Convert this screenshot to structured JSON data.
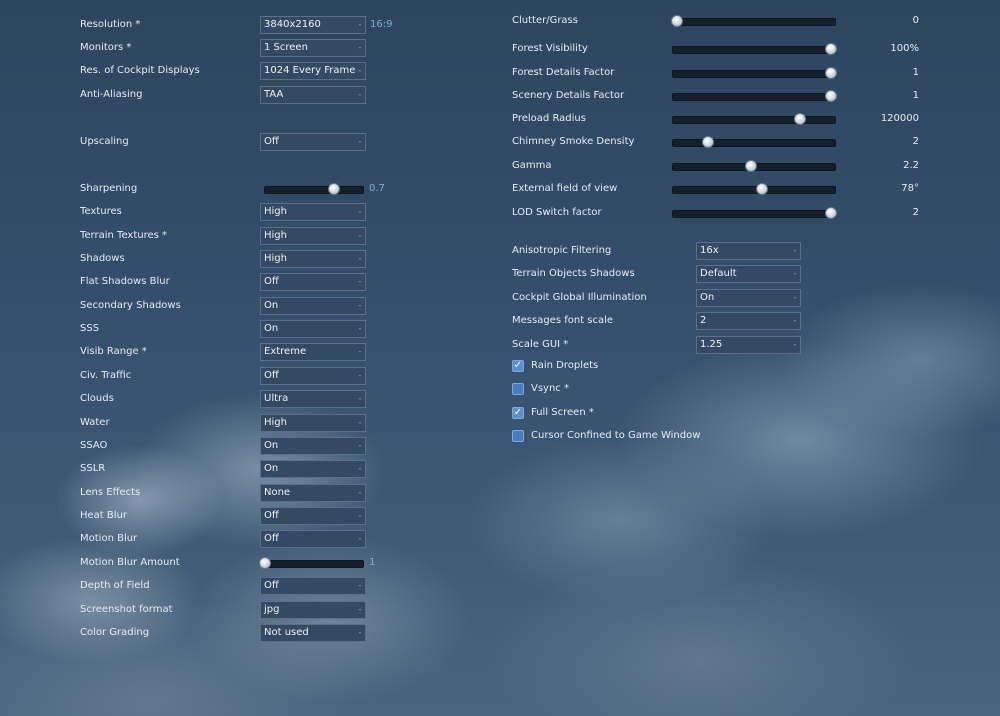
{
  "left": [
    {
      "id": "resolution",
      "kind": "dropdown",
      "label": "Resolution *",
      "value": "3840x2160",
      "note": "16:9"
    },
    {
      "id": "monitors",
      "kind": "dropdown",
      "label": "Monitors *",
      "value": "1 Screen"
    },
    {
      "id": "cockpit-displays",
      "kind": "dropdown",
      "label": "Res. of Cockpit Displays",
      "value": "1024 Every Frame"
    },
    {
      "id": "anti-aliasing",
      "kind": "dropdown",
      "label": "Anti-Aliasing",
      "value": "TAA"
    },
    {
      "id": "upscaling",
      "kind": "dropdown",
      "label": "Upscaling",
      "value": "Off"
    },
    {
      "id": "sharpening",
      "kind": "slider",
      "label": "Sharpening",
      "value": "0.7",
      "fraction": 0.7
    },
    {
      "id": "textures",
      "kind": "dropdown",
      "label": "Textures",
      "value": "High"
    },
    {
      "id": "terrain-textures",
      "kind": "dropdown",
      "label": "Terrain Textures *",
      "value": "High"
    },
    {
      "id": "shadows",
      "kind": "dropdown",
      "label": "Shadows",
      "value": "High"
    },
    {
      "id": "flat-shadows-blur",
      "kind": "dropdown",
      "label": "Flat Shadows Blur",
      "value": "Off"
    },
    {
      "id": "secondary-shadows",
      "kind": "dropdown",
      "label": "Secondary Shadows",
      "value": "On"
    },
    {
      "id": "sss",
      "kind": "dropdown",
      "label": "SSS",
      "value": "On"
    },
    {
      "id": "visib-range",
      "kind": "dropdown",
      "label": "Visib Range *",
      "value": "Extreme"
    },
    {
      "id": "civ-traffic",
      "kind": "dropdown",
      "label": "Civ. Traffic",
      "value": "Off"
    },
    {
      "id": "clouds",
      "kind": "dropdown",
      "label": "Clouds",
      "value": "Ultra"
    },
    {
      "id": "water",
      "kind": "dropdown",
      "label": "Water",
      "value": "High"
    },
    {
      "id": "ssao",
      "kind": "dropdown",
      "label": "SSAO",
      "value": "On"
    },
    {
      "id": "sslr",
      "kind": "dropdown",
      "label": "SSLR",
      "value": "On"
    },
    {
      "id": "lens-effects",
      "kind": "dropdown",
      "label": "Lens Effects",
      "value": "None"
    },
    {
      "id": "heat-blur",
      "kind": "dropdown",
      "label": "Heat Blur",
      "value": "Off"
    },
    {
      "id": "motion-blur",
      "kind": "dropdown",
      "label": "Motion Blur",
      "value": "Off"
    },
    {
      "id": "motion-blur-amount",
      "kind": "slider",
      "label": "Motion Blur Amount",
      "value": "1",
      "fraction": 0.0
    },
    {
      "id": "depth-of-field",
      "kind": "dropdown",
      "label": "Depth of Field",
      "value": "Off"
    },
    {
      "id": "screenshot-format",
      "kind": "dropdown",
      "label": "Screenshot format",
      "value": "jpg"
    },
    {
      "id": "color-grading",
      "kind": "dropdown",
      "label": "Color Grading",
      "value": "Not used"
    }
  ],
  "right_sliders": [
    {
      "id": "clutter-grass",
      "label": "Clutter/Grass",
      "value": "0",
      "fraction": 0.0
    },
    {
      "id": "forest-visibility",
      "label": "Forest Visibility",
      "value": "100%",
      "fraction": 1.0
    },
    {
      "id": "forest-details-factor",
      "label": "Forest Details Factor",
      "value": "1",
      "fraction": 1.0
    },
    {
      "id": "scenery-details-factor",
      "label": "Scenery Details Factor",
      "value": "1",
      "fraction": 1.0
    },
    {
      "id": "preload-radius",
      "label": "Preload Radius",
      "value": "120000",
      "fraction": 0.8
    },
    {
      "id": "chimney-smoke-density",
      "label": "Chimney Smoke Density",
      "value": "2",
      "fraction": 0.2
    },
    {
      "id": "gamma",
      "label": "Gamma",
      "value": "2.2",
      "fraction": 0.48
    },
    {
      "id": "external-fov",
      "label": "External field of view",
      "value": "78°",
      "fraction": 0.55
    },
    {
      "id": "lod-switch-factor",
      "label": "LOD Switch factor",
      "value": "2",
      "fraction": 1.0
    }
  ],
  "right_dropdowns": [
    {
      "id": "anisotropic-filtering",
      "label": "Anisotropic Filtering",
      "value": "16x"
    },
    {
      "id": "terrain-objects-shadows",
      "label": "Terrain Objects Shadows",
      "value": "Default"
    },
    {
      "id": "cockpit-global-illumination",
      "label": "Cockpit Global Illumination",
      "value": "On"
    },
    {
      "id": "messages-font-scale",
      "label": "Messages font scale",
      "value": "2"
    },
    {
      "id": "scale-gui",
      "label": "Scale GUI *",
      "value": "1.25"
    }
  ],
  "right_checkboxes": [
    {
      "id": "rain-droplets",
      "label": "Rain Droplets",
      "checked": true
    },
    {
      "id": "vsync",
      "label": "Vsync *",
      "checked": false
    },
    {
      "id": "full-screen",
      "label": "Full Screen *",
      "checked": true
    },
    {
      "id": "cursor-confined",
      "label": "Cursor Confined to Game Window",
      "checked": false
    }
  ],
  "icons": {
    "dropdown_arrow": "chevron-down-icon",
    "check": "checkmark-icon"
  }
}
